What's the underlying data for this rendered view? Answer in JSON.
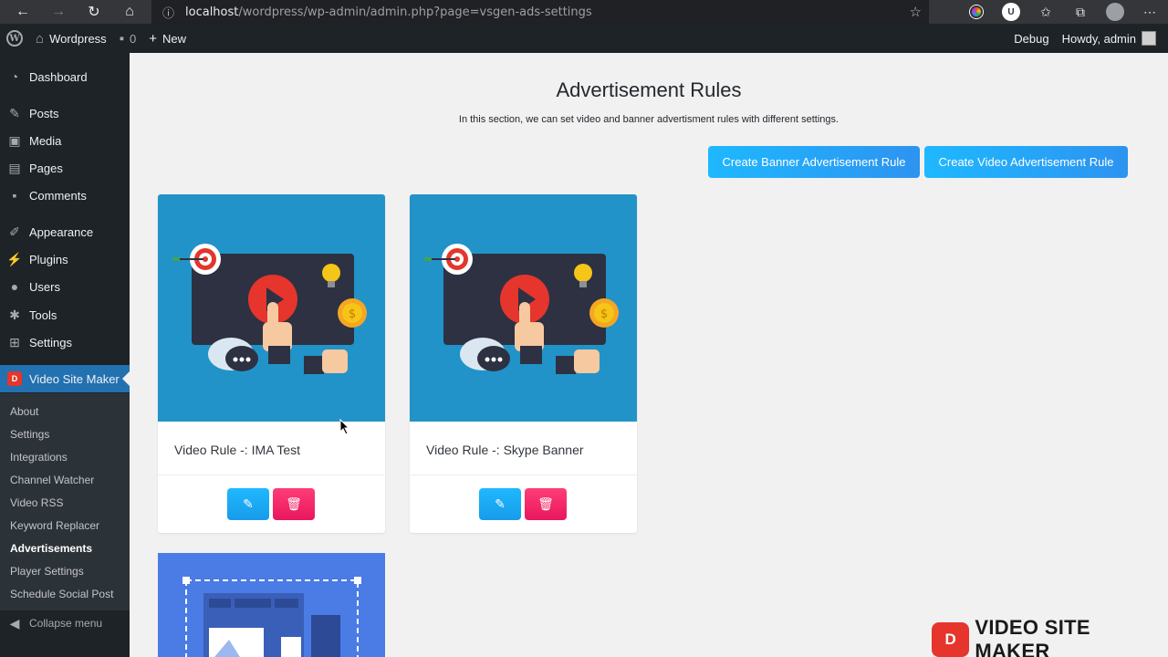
{
  "browser": {
    "url_host": "localhost",
    "url_path": "/wordpress/wp-admin/admin.php?page=vsgen-ads-settings",
    "icons": [
      "back-arrow-icon",
      "forward-arrow-icon",
      "reload-icon",
      "home-icon",
      "info-icon",
      "star-icon"
    ]
  },
  "adminbar": {
    "site_name": "Wordpress",
    "comments_count": "0",
    "new_label": "New",
    "debug_label": "Debug",
    "howdy_label": "Howdy, admin"
  },
  "sidebar": {
    "items": [
      {
        "label": "Dashboard",
        "icon": "dashboard-icon"
      },
      {
        "label": "Posts",
        "icon": "pin-icon"
      },
      {
        "label": "Media",
        "icon": "media-icon"
      },
      {
        "label": "Pages",
        "icon": "pages-icon"
      },
      {
        "label": "Comments",
        "icon": "comment-icon"
      },
      {
        "label": "Appearance",
        "icon": "brush-icon"
      },
      {
        "label": "Plugins",
        "icon": "plug-icon"
      },
      {
        "label": "Users",
        "icon": "user-icon"
      },
      {
        "label": "Tools",
        "icon": "wrench-icon"
      },
      {
        "label": "Settings",
        "icon": "settings-icon"
      },
      {
        "label": "Video Site Maker",
        "icon": "vsm-icon"
      }
    ],
    "submenu": [
      {
        "label": "About"
      },
      {
        "label": "Settings"
      },
      {
        "label": "Integrations"
      },
      {
        "label": "Channel Watcher"
      },
      {
        "label": "Video RSS"
      },
      {
        "label": "Keyword Replacer"
      },
      {
        "label": "Advertisements"
      },
      {
        "label": "Player Settings"
      },
      {
        "label": "Schedule Social Post"
      }
    ],
    "collapse_label": "Collapse menu"
  },
  "main": {
    "title": "Advertisement Rules",
    "description": "In this section, we can set video and banner advertisment rules with different settings.",
    "create_banner_label": "Create Banner Advertisement Rule",
    "create_video_label": "Create Video Advertisement Rule",
    "cards": [
      {
        "title": "Video Rule -: IMA Test"
      },
      {
        "title": "Video Rule -: Skype Banner"
      }
    ]
  },
  "colors": {
    "accent": "#2271b1",
    "button_blue": "#1fb8ff",
    "button_pink": "#ff3d77",
    "card_image_bg": "#2193c9",
    "banner_bg": "#4b7be5"
  },
  "watermark": {
    "logo_text": "D",
    "text": "VIDEO SITE MAKER"
  }
}
